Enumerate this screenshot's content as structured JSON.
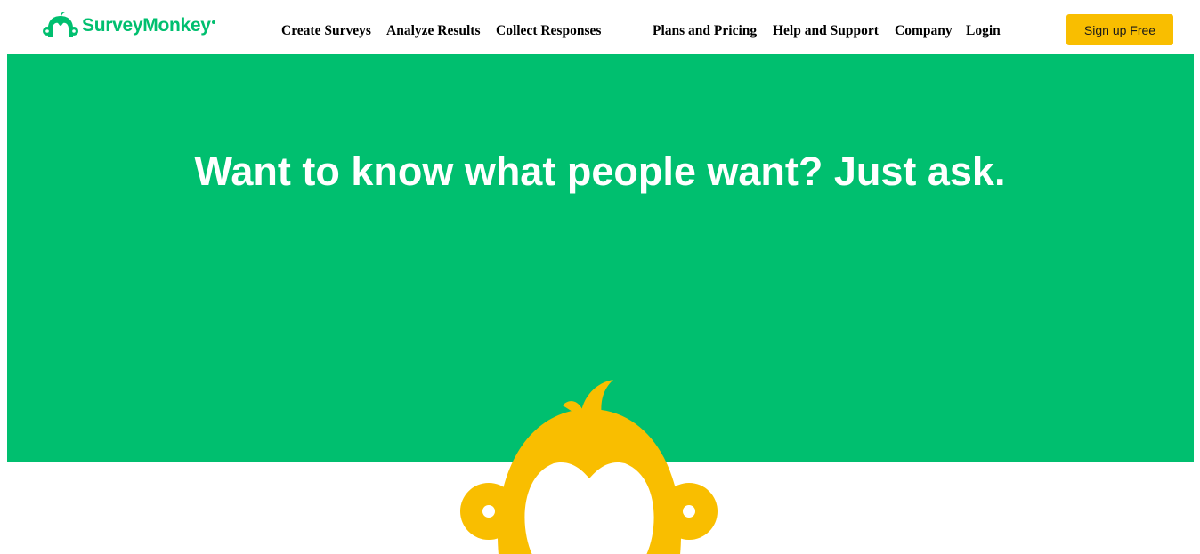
{
  "header": {
    "brand": "SurveyMonkey",
    "nav": [
      {
        "label": "Create Surveys"
      },
      {
        "label": "Analyze Results"
      },
      {
        "label": "Collect Responses"
      },
      {
        "label": "Plans and Pricing"
      },
      {
        "label": "Help and Support"
      },
      {
        "label": "Company"
      },
      {
        "label": "Login"
      }
    ],
    "cta_label": "Sign up Free"
  },
  "hero": {
    "headline": "Want to know what people want? Just ask."
  },
  "colors": {
    "brand_green": "#00bf6f",
    "cta_yellow": "#f9be00",
    "mascot_yellow": "#f9be00"
  },
  "icons": {
    "logo": "surveymonkey-logo-icon",
    "mascot": "monkey-mascot-icon"
  }
}
